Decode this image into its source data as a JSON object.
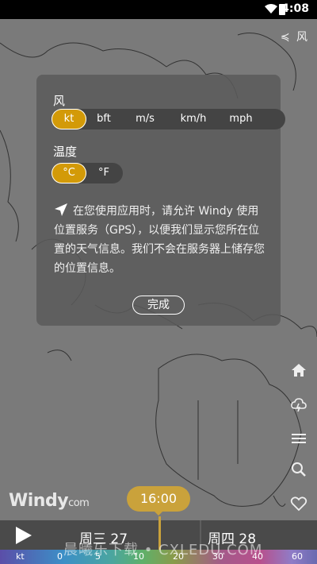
{
  "status_bar": {
    "time": "4:08"
  },
  "map_layer": {
    "label": "风",
    "icon": "wind-layer-icon"
  },
  "dialog": {
    "wind_label": "风",
    "wind_units": [
      "kt",
      "bft",
      "m/s",
      "km/h",
      "mph"
    ],
    "wind_selected": "kt",
    "temp_label": "温度",
    "temp_units": [
      "°C",
      "°F"
    ],
    "temp_selected": "°C",
    "location_message": "在您使用应用时，请允许 Windy 使用位置服务（GPS），以便我们显示您所在位置的天气信息。我们不会在服务器上储存您的位置信息。",
    "done_label": "完成"
  },
  "side_icons": [
    "home-icon",
    "cloud-icon",
    "menu-icon",
    "search-icon",
    "heart-icon"
  ],
  "logo": {
    "main": "Windy",
    "suffix": "com"
  },
  "timeline": {
    "current_time": "16:00",
    "day1": "周三 27",
    "day2": "周四 28"
  },
  "scale": {
    "unit": "kt",
    "ticks": [
      "0",
      "5",
      "10",
      "20",
      "30",
      "40",
      "60"
    ]
  },
  "watermark": "晨曦乐下载 • CXLEDU.COM",
  "colors": {
    "accent": "#d39a08",
    "time_bubble": "#caa23b"
  }
}
